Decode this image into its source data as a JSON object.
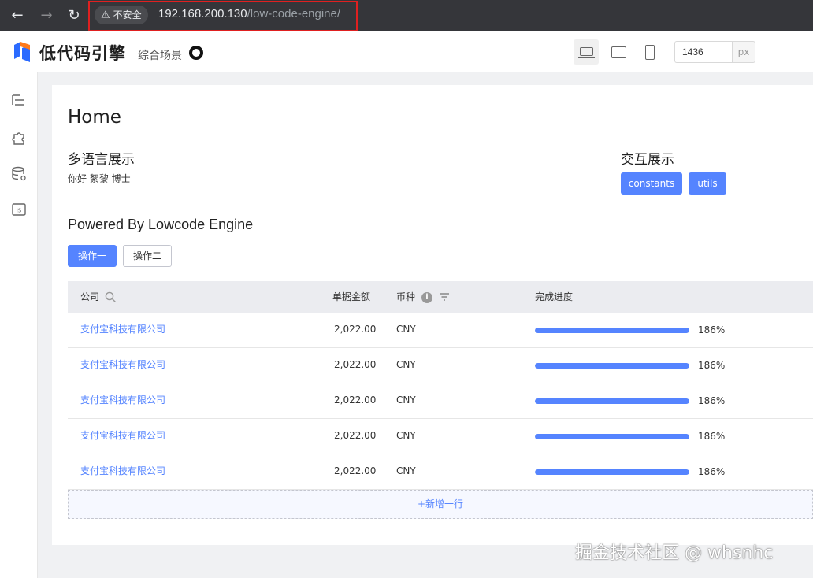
{
  "browser": {
    "security_label": "不安全",
    "url_host": "192.168.200.130",
    "url_path": "/low-code-engine/"
  },
  "topbar": {
    "logo_text": "低代码引擎",
    "scene_label": "综合场景",
    "canvas_width": "1436",
    "width_unit": "px"
  },
  "page": {
    "title": "Home",
    "i18n_heading": "多语言展示",
    "greeting": "你好  絮黎 博士",
    "interact_heading": "交互展示",
    "btn_constants": "constants",
    "btn_utils": "utils",
    "powered_heading": "Powered By Lowcode Engine",
    "btn_op1": "操作一",
    "btn_op2": "操作二"
  },
  "table": {
    "headers": [
      "公司",
      "单据金额",
      "币种",
      "完成进度"
    ],
    "rows": [
      {
        "company": "支付宝科技有限公司",
        "amount": "2,022.00",
        "currency": "CNY",
        "progress": 1.86,
        "progress_label": "186%"
      },
      {
        "company": "支付宝科技有限公司",
        "amount": "2,022.00",
        "currency": "CNY",
        "progress": 1.86,
        "progress_label": "186%"
      },
      {
        "company": "支付宝科技有限公司",
        "amount": "2,022.00",
        "currency": "CNY",
        "progress": 1.86,
        "progress_label": "186%"
      },
      {
        "company": "支付宝科技有限公司",
        "amount": "2,022.00",
        "currency": "CNY",
        "progress": 1.86,
        "progress_label": "186%"
      },
      {
        "company": "支付宝科技有限公司",
        "amount": "2,022.00",
        "currency": "CNY",
        "progress": 1.86,
        "progress_label": "186%"
      }
    ],
    "add_row_label": "+新增一行"
  },
  "watermark": "掘金技术社区 @ whsnhc",
  "colors": {
    "accent": "#5584ff",
    "chrome": "#35363a",
    "highlight_box": "#e02020"
  }
}
